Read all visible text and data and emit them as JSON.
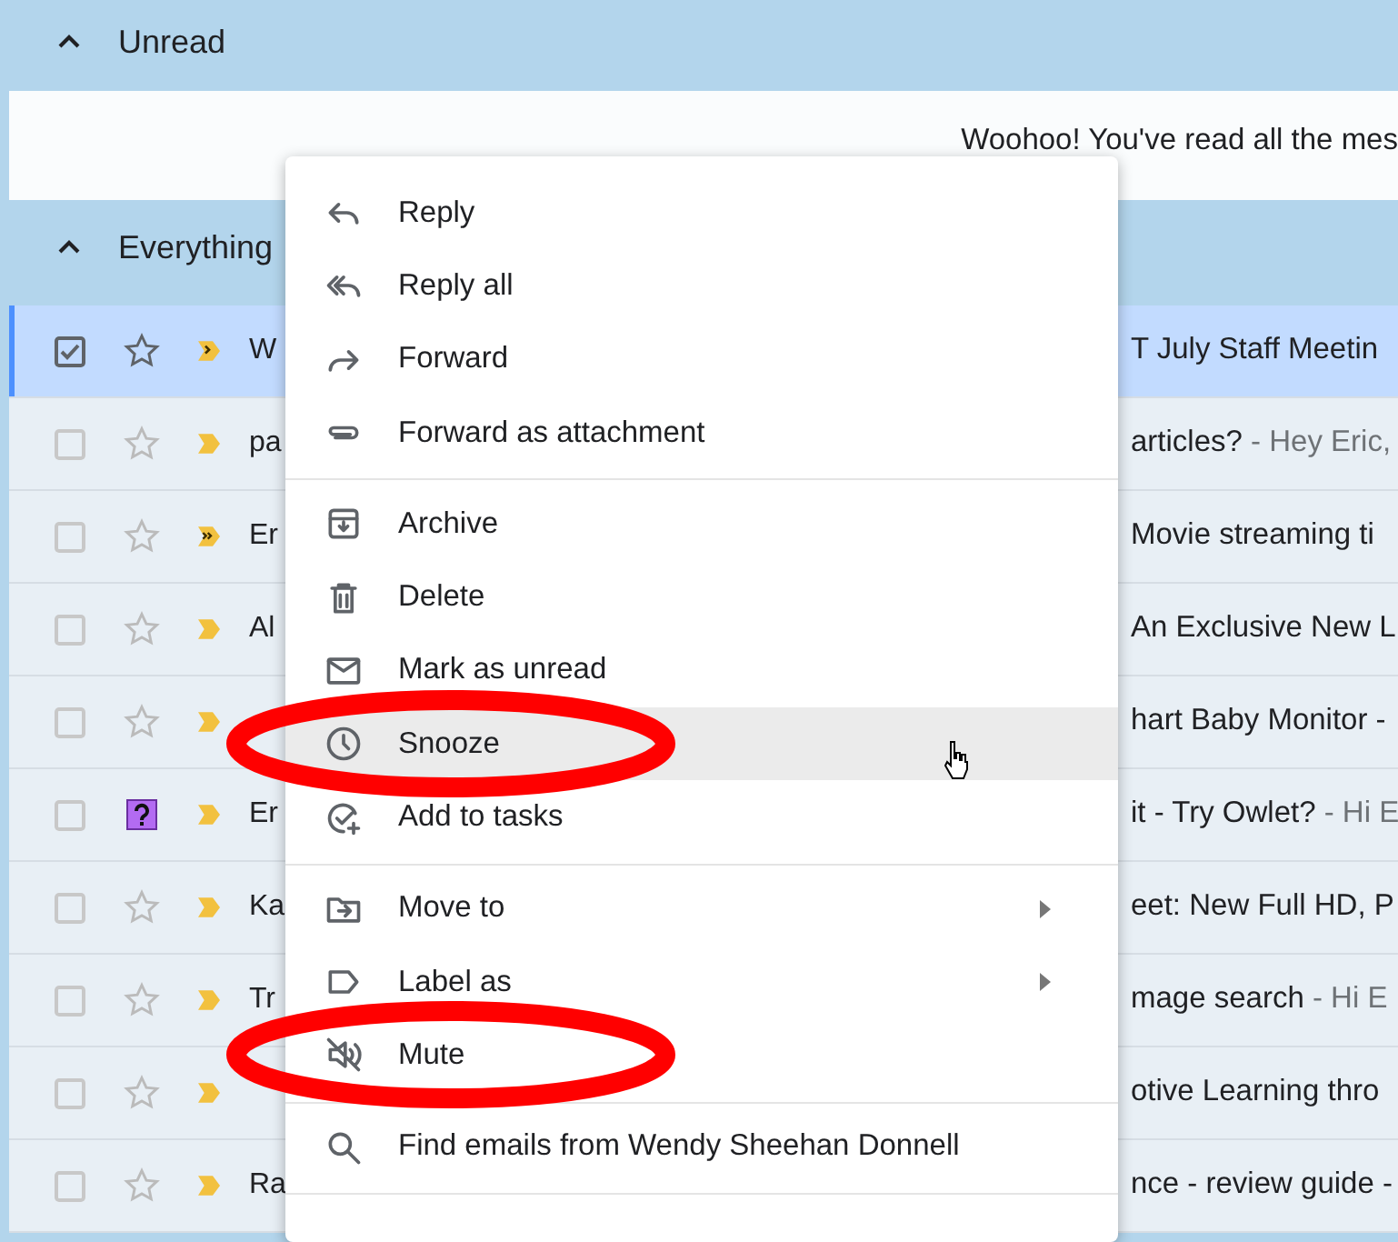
{
  "sections": [
    {
      "title": "Unread",
      "expanded": true,
      "message": "Woohoo! You've read all the mes"
    },
    {
      "title": "Everything",
      "expanded": true
    }
  ],
  "rows": [
    {
      "kind": "important",
      "selected": true,
      "question": false,
      "sender": "W",
      "subject": "T July Staff Meetin",
      "snippet": ""
    },
    {
      "kind": "plain",
      "selected": false,
      "question": false,
      "sender": "pa",
      "subject": "articles?",
      "snippet": " - Hey Eric,"
    },
    {
      "kind": "double",
      "selected": false,
      "question": false,
      "sender": "Er",
      "subject": "Movie streaming ti",
      "snippet": ""
    },
    {
      "kind": "plain",
      "selected": false,
      "question": false,
      "sender": "Al",
      "subject": "An Exclusive New L",
      "snippet": ""
    },
    {
      "kind": "plain",
      "selected": false,
      "question": false,
      "sender": "",
      "subject": "hart Baby Monitor -",
      "snippet": ""
    },
    {
      "kind": "plain",
      "selected": false,
      "question": true,
      "sender": "Er",
      "subject": "it - Try Owlet?",
      "snippet": " - Hi E"
    },
    {
      "kind": "plain",
      "selected": false,
      "question": false,
      "sender": "Ka",
      "subject": "eet: New Full HD, P",
      "snippet": ""
    },
    {
      "kind": "plain",
      "selected": false,
      "question": false,
      "sender": "Tr",
      "subject": "mage search",
      "snippet": " - Hi E"
    },
    {
      "kind": "plain",
      "selected": false,
      "question": false,
      "sender": "",
      "subject": "otive Learning thro",
      "snippet": ""
    },
    {
      "kind": "plain",
      "selected": false,
      "question": false,
      "sender": "Ra",
      "subject": "nce - review guide -",
      "snippet": ""
    }
  ],
  "context_menu": {
    "groups": [
      [
        {
          "label": "Reply",
          "hovered": false,
          "submenu": false,
          "circled": false
        },
        {
          "label": "Reply all",
          "hovered": false,
          "submenu": false,
          "circled": false
        },
        {
          "label": "Forward",
          "hovered": false,
          "submenu": false,
          "circled": false
        },
        {
          "label": "Forward as attachment",
          "hovered": false,
          "submenu": false,
          "circled": false
        }
      ],
      [
        {
          "label": "Archive",
          "hovered": false,
          "submenu": false,
          "circled": false
        },
        {
          "label": "Delete",
          "hovered": false,
          "submenu": false,
          "circled": false
        },
        {
          "label": "Mark as unread",
          "hovered": false,
          "submenu": false,
          "circled": false
        },
        {
          "label": "Snooze",
          "hovered": true,
          "submenu": false,
          "circled": true
        },
        {
          "label": "Add to tasks",
          "hovered": false,
          "submenu": false,
          "circled": false
        }
      ],
      [
        {
          "label": "Move to",
          "hovered": false,
          "submenu": true,
          "circled": false
        },
        {
          "label": "Label as",
          "hovered": false,
          "submenu": true,
          "circled": false
        },
        {
          "label": "Mute",
          "hovered": false,
          "submenu": false,
          "circled": true
        }
      ],
      [
        {
          "label": "Find emails from Wendy Sheehan Donnell",
          "hovered": false,
          "submenu": false,
          "circled": false
        }
      ]
    ]
  }
}
